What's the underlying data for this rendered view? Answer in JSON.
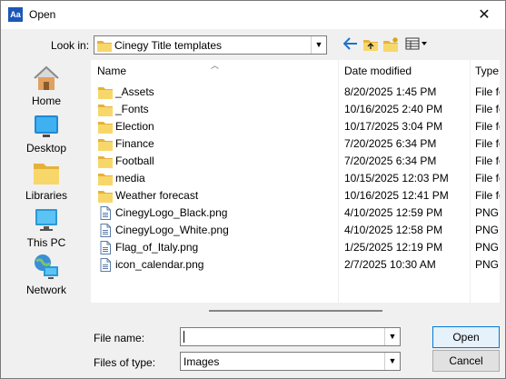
{
  "dialog": {
    "title": "Open",
    "app_icon_text": "Aa",
    "close_glyph": "✕"
  },
  "toolbar": {
    "look_in_label": "Look in:",
    "look_in_value": "Cinegy Title templates",
    "nav_icons": [
      "back-arrow-icon",
      "up-folder-icon",
      "new-folder-icon",
      "view-menu-icon"
    ]
  },
  "places": [
    {
      "label": "Home",
      "icon": "home-icon"
    },
    {
      "label": "Desktop",
      "icon": "desktop-icon"
    },
    {
      "label": "Libraries",
      "icon": "libraries-icon"
    },
    {
      "label": "This PC",
      "icon": "this-pc-icon"
    },
    {
      "label": "Network",
      "icon": "network-icon"
    }
  ],
  "columns": {
    "name": "Name",
    "date": "Date modified",
    "type": "Type"
  },
  "files": [
    {
      "name": "_Assets",
      "date": "8/20/2025 1:45 PM",
      "type": "File fo",
      "kind": "folder"
    },
    {
      "name": "_Fonts",
      "date": "10/16/2025 2:40 PM",
      "type": "File fo",
      "kind": "folder"
    },
    {
      "name": "Election",
      "date": "10/17/2025 3:04 PM",
      "type": "File fo",
      "kind": "folder"
    },
    {
      "name": "Finance",
      "date": "7/20/2025 6:34 PM",
      "type": "File fo",
      "kind": "folder"
    },
    {
      "name": "Football",
      "date": "7/20/2025 6:34 PM",
      "type": "File fo",
      "kind": "folder"
    },
    {
      "name": "media",
      "date": "10/15/2025 12:03 PM",
      "type": "File fo",
      "kind": "folder"
    },
    {
      "name": "Weather forecast",
      "date": "10/16/2025 12:41 PM",
      "type": "File fo",
      "kind": "folder"
    },
    {
      "name": "CinegyLogo_Black.png",
      "date": "4/10/2025 12:59 PM",
      "type": "PNG",
      "kind": "file"
    },
    {
      "name": "CinegyLogo_White.png",
      "date": "4/10/2025 12:58 PM",
      "type": "PNG",
      "kind": "file"
    },
    {
      "name": "Flag_of_Italy.png",
      "date": "1/25/2025 12:19 PM",
      "type": "PNG",
      "kind": "file"
    },
    {
      "name": "icon_calendar.png",
      "date": "2/7/2025 10:30 AM",
      "type": "PNG",
      "kind": "file"
    }
  ],
  "form": {
    "file_name_label": "File name:",
    "file_name_value": "",
    "files_of_type_label": "Files of type:",
    "files_of_type_value": "Images",
    "open_button": "Open",
    "cancel_button": "Cancel"
  },
  "colors": {
    "accent": "#0078d7",
    "folder": "#f2c84b",
    "window_bg": "#f0f0f0"
  }
}
